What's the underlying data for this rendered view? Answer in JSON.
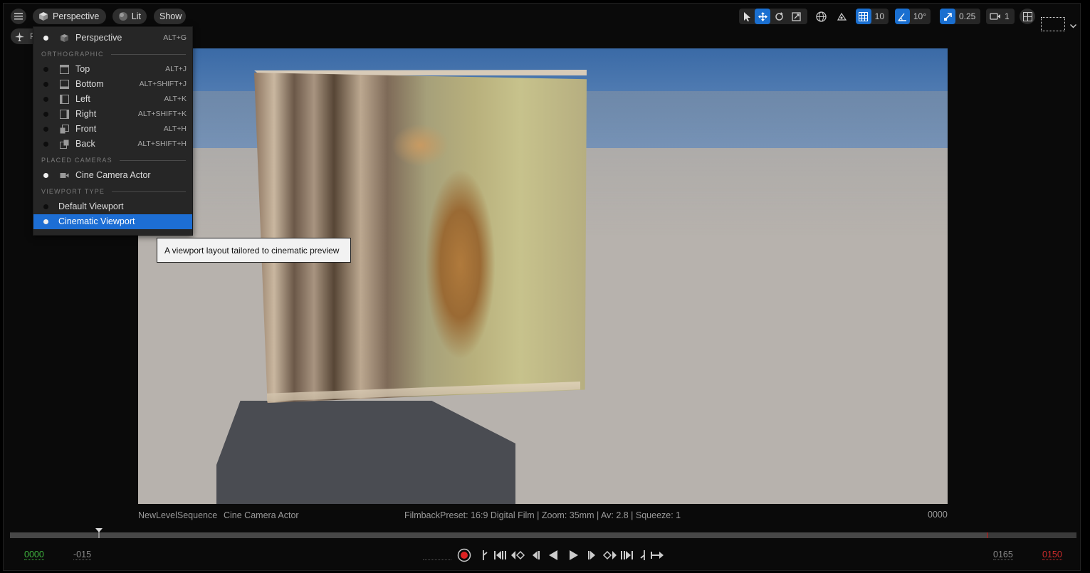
{
  "toolbar": {
    "view_mode": "Perspective",
    "lighting": "Lit",
    "show": "Show",
    "grid_snap": "10",
    "rotation_snap": "10°",
    "scale_snap": "0.25",
    "camera_speed": "1",
    "pilot_label": "P"
  },
  "menu": {
    "perspective": {
      "label": "Perspective",
      "shortcut": "ALT+G"
    },
    "section_ortho": "ORTHOGRAPHIC",
    "ortho": [
      {
        "label": "Top",
        "shortcut": "ALT+J"
      },
      {
        "label": "Bottom",
        "shortcut": "ALT+SHIFT+J"
      },
      {
        "label": "Left",
        "shortcut": "ALT+K"
      },
      {
        "label": "Right",
        "shortcut": "ALT+SHIFT+K"
      },
      {
        "label": "Front",
        "shortcut": "ALT+H"
      },
      {
        "label": "Back",
        "shortcut": "ALT+SHIFT+H"
      }
    ],
    "section_cameras": "PLACED CAMERAS",
    "camera": {
      "label": "Cine Camera Actor"
    },
    "section_type": "VIEWPORT TYPE",
    "types": [
      {
        "label": "Default Viewport"
      },
      {
        "label": "Cinematic Viewport"
      }
    ]
  },
  "tooltip": "A viewport layout tailored to cinematic preview",
  "info": {
    "sequence": "NewLevelSequence",
    "camera": "Cine Camera Actor",
    "filmback": "FilmbackPreset: 16:9 Digital Film | Zoom: 35mm | Av: 2.8 | Squeeze: 1",
    "frame": "0000"
  },
  "timecodes": {
    "start": "0000",
    "view_start": "-015",
    "view_end": "0165",
    "end": "0150"
  },
  "colors": {
    "accent": "#1d6ed4",
    "start_green": "#3fb53f",
    "end_red": "#cc2b2b"
  }
}
